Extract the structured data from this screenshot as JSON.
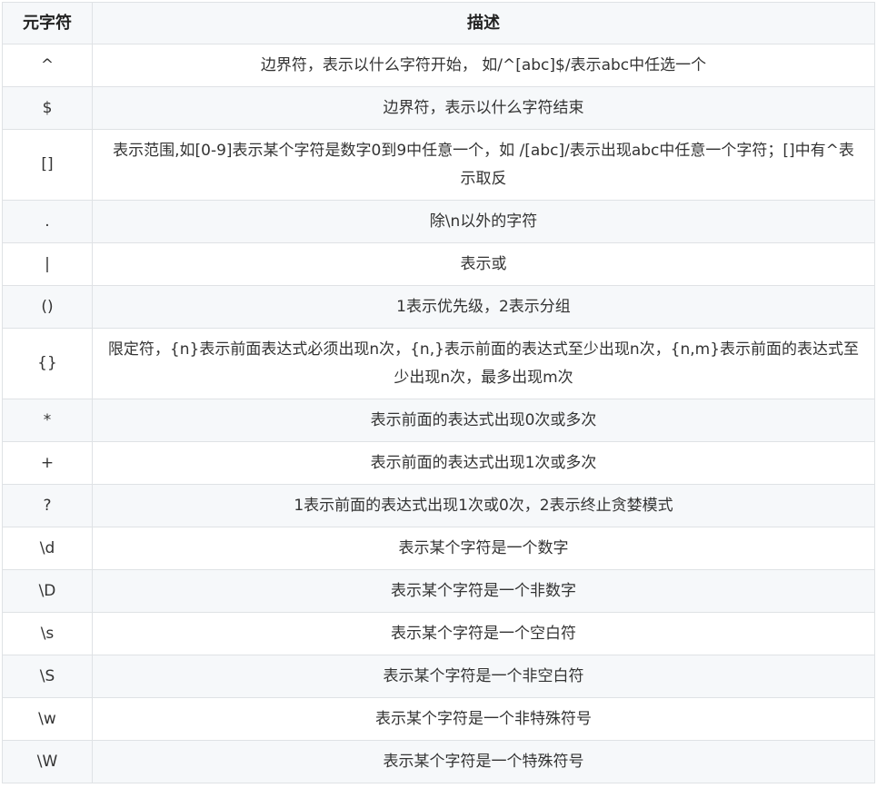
{
  "table": {
    "headers": [
      "元字符",
      "描述"
    ],
    "rows": [
      {
        "symbol": "^",
        "desc": "边界符，表示以什么字符开始， 如/^[abc]$/表示abc中任选一个"
      },
      {
        "symbol": "$",
        "desc": "边界符，表示以什么字符结束"
      },
      {
        "symbol": "[]",
        "desc": "表示范围,如[0-9]表示某个字符是数字0到9中任意一个，如 /[abc]/表示出现abc中任意一个字符；[]中有^表示取反"
      },
      {
        "symbol": ".",
        "desc": "除\\n以外的字符"
      },
      {
        "symbol": "|",
        "desc": "表示或"
      },
      {
        "symbol": "()",
        "desc": "1表示优先级，2表示分组"
      },
      {
        "symbol": "{}",
        "desc": "限定符，{n}表示前面表达式必须出现n次，{n,}表示前面的表达式至少出现n次，{n,m}表示前面的表达式至少出现n次，最多出现m次"
      },
      {
        "symbol": "*",
        "desc": "表示前面的表达式出现0次或多次"
      },
      {
        "symbol": "+",
        "desc": "表示前面的表达式出现1次或多次"
      },
      {
        "symbol": "?",
        "desc": "1表示前面的表达式出现1次或0次，2表示终止贪婪模式"
      },
      {
        "symbol": "\\d",
        "desc": "表示某个字符是一个数字"
      },
      {
        "symbol": "\\D",
        "desc": "表示某个字符是一个非数字"
      },
      {
        "symbol": "\\s",
        "desc": "表示某个字符是一个空白符"
      },
      {
        "symbol": "\\S",
        "desc": "表示某个字符是一个非空白符"
      },
      {
        "symbol": "\\w",
        "desc": "表示某个字符是一个非特殊符号"
      },
      {
        "symbol": "\\W",
        "desc": "表示某个字符是一个特殊符号"
      }
    ]
  }
}
